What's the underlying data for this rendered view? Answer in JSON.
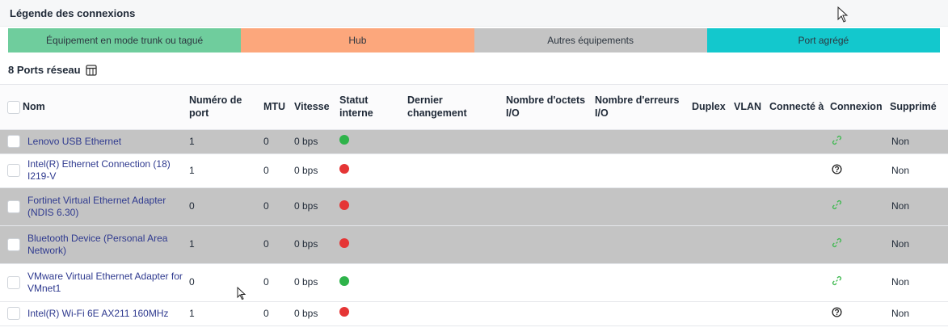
{
  "legend": {
    "title": "Légende des connexions",
    "items": [
      {
        "label": "Équipement en mode trunk ou tagué",
        "color": "#6fcd9d"
      },
      {
        "label": "Hub",
        "color": "#fca77c"
      },
      {
        "label": "Autres équipements",
        "color": "#c4c4c4"
      },
      {
        "label": "Port agrégé",
        "color": "#13c8cd"
      }
    ]
  },
  "ports": {
    "title": "8 Ports réseau",
    "columns": {
      "name": "Nom",
      "port_number": "Numéro de port",
      "mtu": "MTU",
      "speed": "Vitesse",
      "status": "Statut interne",
      "last_change": "Dernier changement",
      "octets": "Nombre d'octets I/O",
      "errors": "Nombre d'erreurs I/O",
      "duplex": "Duplex",
      "vlan": "VLAN",
      "connected": "Connecté à",
      "connection": "Connexion",
      "deleted": "Supprimé"
    },
    "rows": [
      {
        "name": "Lenovo USB Ethernet",
        "port": "1",
        "mtu": "0",
        "speed": "0 bps",
        "status": "green",
        "connection": "link-icon",
        "deleted": "Non",
        "shaded": true
      },
      {
        "name": "Intel(R) Ethernet Connection (18) I219-V",
        "port": "1",
        "mtu": "0",
        "speed": "0 bps",
        "status": "red",
        "connection": "help-icon",
        "deleted": "Non",
        "shaded": false
      },
      {
        "name": "Fortinet Virtual Ethernet Adapter (NDIS 6.30)",
        "port": "0",
        "mtu": "0",
        "speed": "0 bps",
        "status": "red",
        "connection": "link-icon",
        "deleted": "Non",
        "shaded": true
      },
      {
        "name": "Bluetooth Device (Personal Area Network)",
        "port": "1",
        "mtu": "0",
        "speed": "0 bps",
        "status": "red",
        "connection": "link-icon",
        "deleted": "Non",
        "shaded": true
      },
      {
        "name": "VMware Virtual Ethernet Adapter for VMnet1",
        "port": "0",
        "mtu": "0",
        "speed": "0 bps",
        "status": "green",
        "connection": "link-icon",
        "deleted": "Non",
        "shaded": false
      },
      {
        "name": "Intel(R) Wi-Fi 6E AX211 160MHz",
        "port": "1",
        "mtu": "0",
        "speed": "0 bps",
        "status": "red",
        "connection": "help-icon",
        "deleted": "Non",
        "shaded": false
      }
    ]
  }
}
